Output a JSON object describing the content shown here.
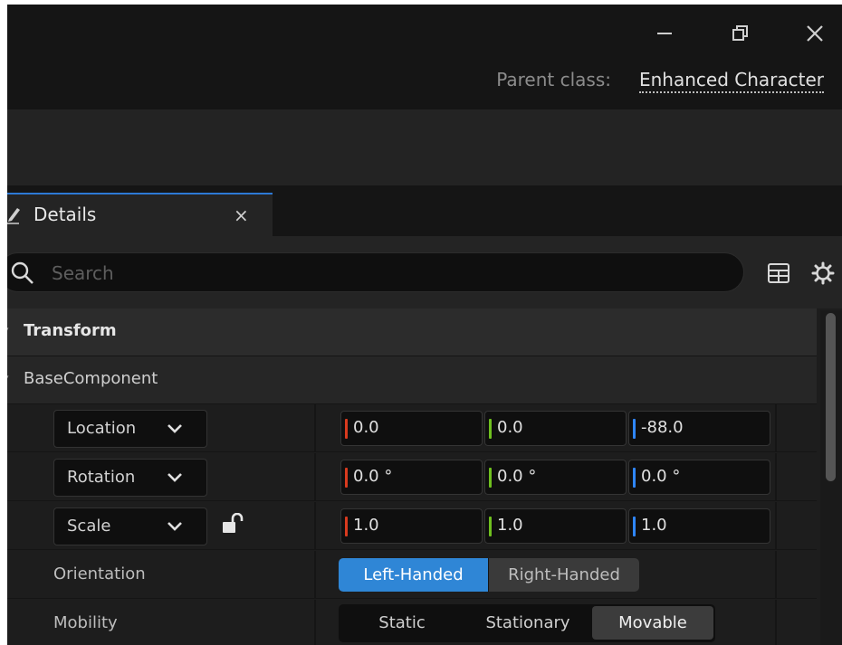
{
  "window": {
    "parent_class_label": "Parent class:",
    "parent_class_value": "Enhanced Character"
  },
  "tab": {
    "title": "Details",
    "close_glyph": "×"
  },
  "search": {
    "placeholder": "Search",
    "value": ""
  },
  "sections": {
    "transform": "Transform",
    "base_component": "BaseComponent"
  },
  "properties": {
    "location": {
      "label": "Location",
      "x": "0.0",
      "y": "0.0",
      "z": "-88.0"
    },
    "rotation": {
      "label": "Rotation",
      "x": "0.0 °",
      "y": "0.0 °",
      "z": "0.0 °"
    },
    "scale": {
      "label": "Scale",
      "x": "1.0",
      "y": "1.0",
      "z": "1.0"
    },
    "orientation": {
      "label": "Orientation",
      "options": [
        "Left-Handed",
        "Right-Handed"
      ],
      "selected": "Left-Handed"
    },
    "mobility": {
      "label": "Mobility",
      "options": [
        "Static",
        "Stationary",
        "Movable"
      ],
      "selected": "Movable"
    }
  },
  "colors": {
    "axis_x": "#d83a1e",
    "axis_y": "#6fbf1f",
    "axis_z": "#2f86ff",
    "accent": "#2f86d6"
  },
  "icons": [
    "minimize-icon",
    "restore-icon",
    "close-icon",
    "edit-icon",
    "search-icon",
    "table-view-icon",
    "settings-gear-icon",
    "unlock-icon",
    "chevron-down-icon"
  ]
}
